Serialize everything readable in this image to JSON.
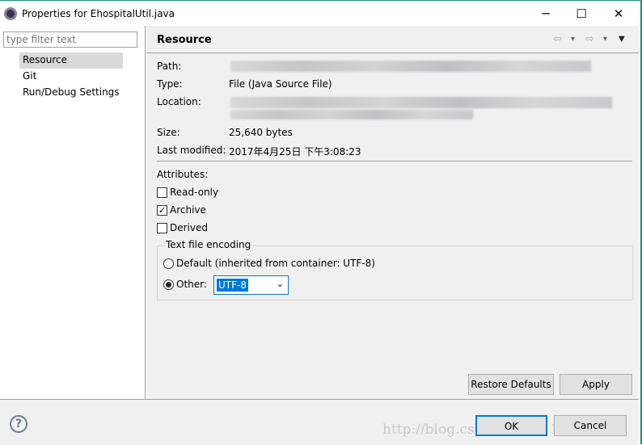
{
  "window": {
    "title": "Properties for EhospitalUtil.java",
    "minimize": "─",
    "maximize": "☐",
    "close": "✕"
  },
  "sidebar": {
    "filter_placeholder": "type filter text",
    "items": [
      {
        "label": "Resource",
        "selected": true
      },
      {
        "label": "Git"
      },
      {
        "label": "Run/Debug Settings"
      }
    ]
  },
  "page": {
    "title": "Resource",
    "nav": {
      "back": "⇦",
      "forward": "⇨",
      "dropdown": "▾",
      "menu": "▼"
    },
    "fields": {
      "path_label": "Path:",
      "type_label": "Type:",
      "type_value": "File  (Java Source File)",
      "location_label": "Location:",
      "size_label": "Size:",
      "size_value": "25,640  bytes",
      "modified_label": "Last modified:",
      "modified_value": "2017年4月25日 下午3:08:23"
    },
    "attributes": {
      "label": "Attributes:",
      "items": [
        {
          "label": "Read-only",
          "checked": false
        },
        {
          "label": "Archive",
          "checked": true
        },
        {
          "label": "Derived",
          "checked": false
        }
      ]
    },
    "encoding": {
      "label": "Text file encoding",
      "default_label": "Default (inherited from container: UTF-8)",
      "other_label": "Other:",
      "selected": "other",
      "value": "UTF-8"
    },
    "restore_defaults": "Restore Defaults",
    "apply": "Apply"
  },
  "footer": {
    "help": "?",
    "ok": "OK",
    "cancel": "Cancel",
    "watermark": "http://blog.csdn.net/u011008029"
  }
}
